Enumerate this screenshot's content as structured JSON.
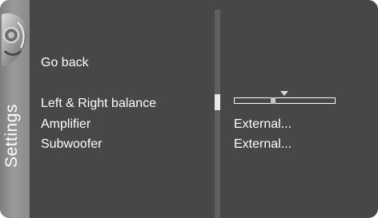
{
  "menu": {
    "title": "Settings",
    "icon": "speaker-headphones-icon",
    "items": [
      {
        "label": "Go back"
      },
      {
        "label": "Left & Right balance",
        "balance_fraction": 0.39
      },
      {
        "label": "Amplifier",
        "value": "External..."
      },
      {
        "label": "Subwoofer",
        "value": "External..."
      }
    ]
  },
  "colors": {
    "panel": "#474747",
    "sidebar": "#8c8c8c",
    "divider": "#5f5f5f",
    "text": "#ffffff"
  }
}
